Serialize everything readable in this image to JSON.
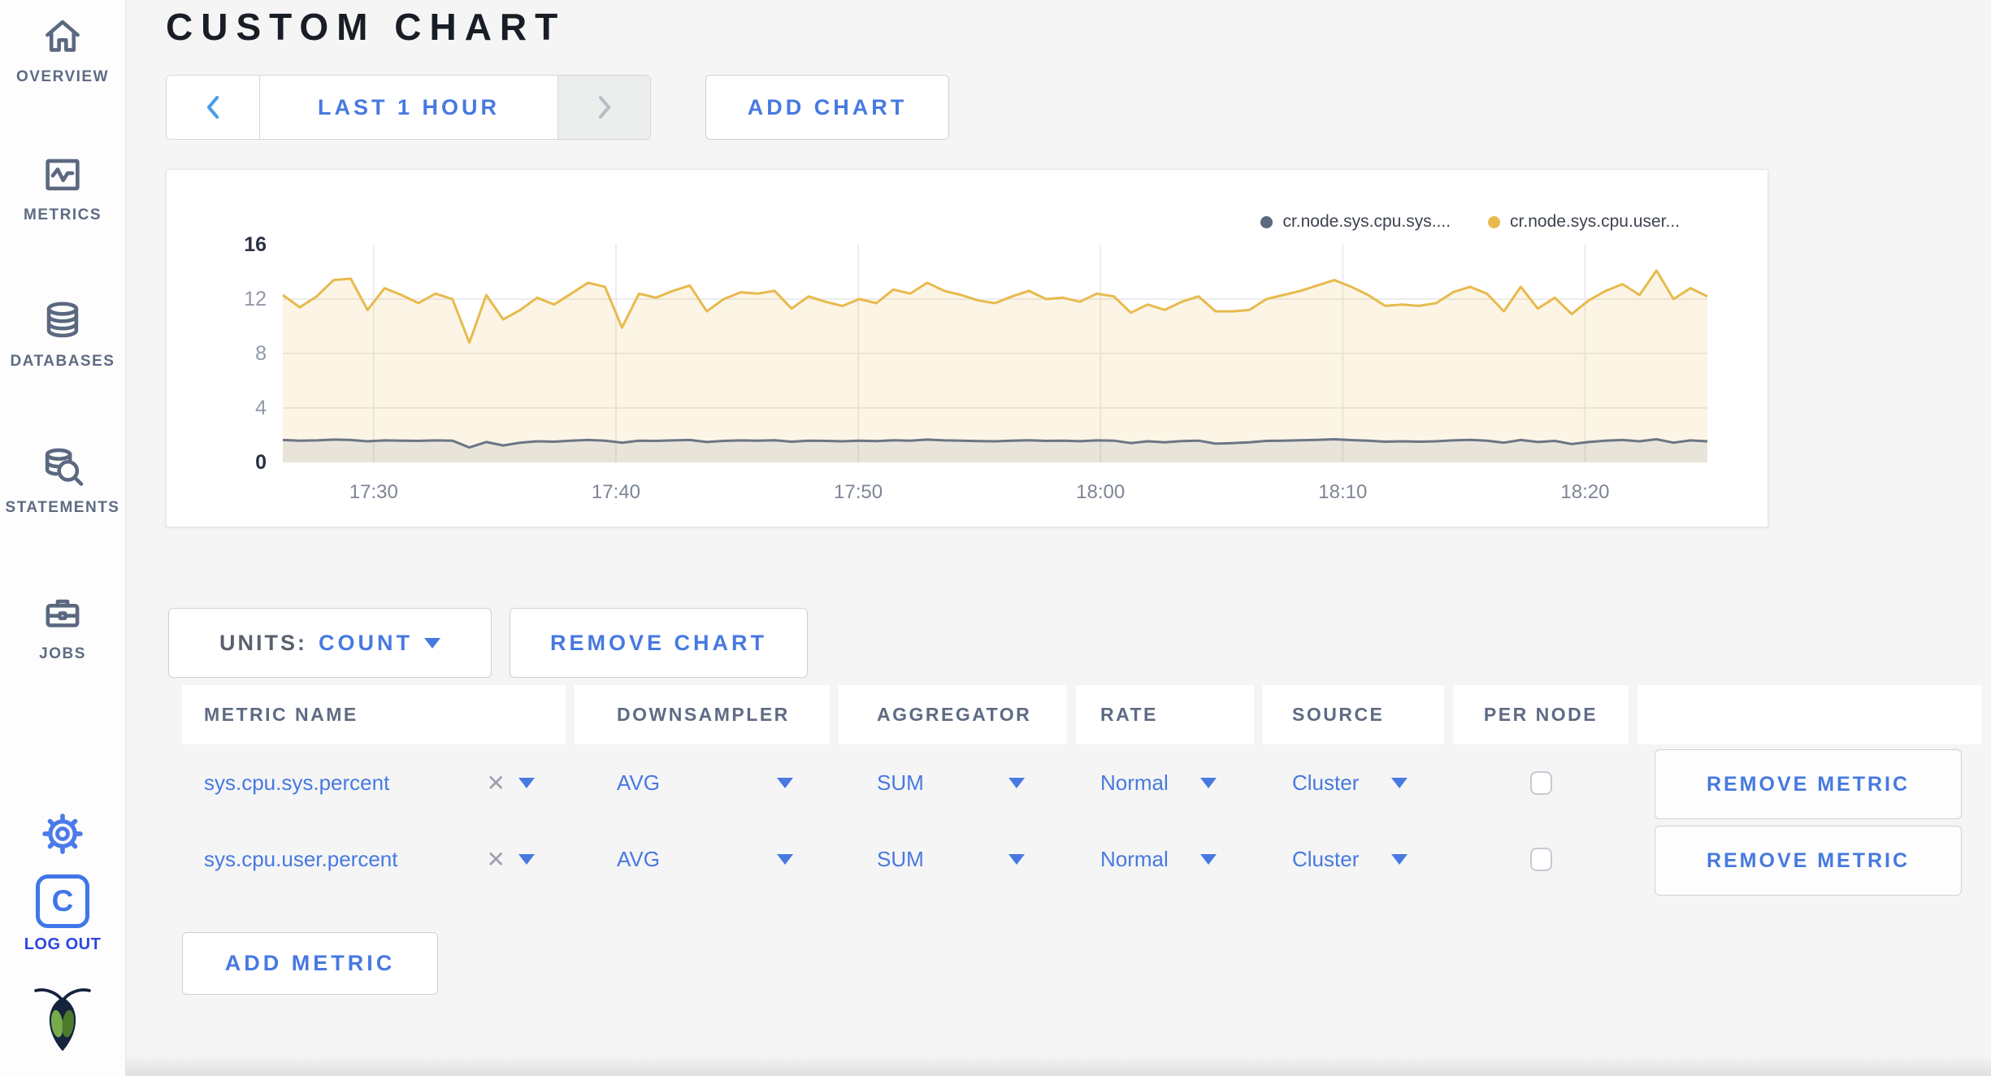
{
  "header": {
    "title": "CUSTOM CHART"
  },
  "sidebar": {
    "items": [
      {
        "label": "OVERVIEW"
      },
      {
        "label": "METRICS"
      },
      {
        "label": "DATABASES"
      },
      {
        "label": "STATEMENTS"
      },
      {
        "label": "JOBS"
      }
    ],
    "logo_letter": "C",
    "logout_label": "LOG OUT"
  },
  "controls": {
    "time_range": "LAST 1 HOUR",
    "add_chart": "ADD CHART"
  },
  "chart_card": {
    "legend": [
      {
        "label": "cr.node.sys.cpu.sys....",
        "color": "#5b6880"
      },
      {
        "label": "cr.node.sys.cpu.user...",
        "color": "#e8ba4d"
      }
    ]
  },
  "chart_data": {
    "type": "area",
    "title": "",
    "xlabel": "",
    "ylabel": "",
    "ylim": [
      0,
      16
    ],
    "y_ticks": [
      0,
      4,
      8,
      12,
      16
    ],
    "x_domain_minutes": [
      0,
      58.8
    ],
    "sample_interval_minutes": 0.7,
    "x_ticks": [
      {
        "label": "17:30",
        "min": 3.75
      },
      {
        "label": "17:40",
        "min": 13.75
      },
      {
        "label": "17:50",
        "min": 23.75
      },
      {
        "label": "18:00",
        "min": 33.75
      },
      {
        "label": "18:10",
        "min": 43.75
      },
      {
        "label": "18:20",
        "min": 53.75
      }
    ],
    "grid": true,
    "legend_position": "top-right",
    "series": [
      {
        "name": "cr.node.sys.cpu.sys....",
        "color": "#6b7585",
        "fill": "rgba(107,117,133,0.13)",
        "values": [
          1.65,
          1.6,
          1.62,
          1.68,
          1.65,
          1.55,
          1.62,
          1.6,
          1.58,
          1.62,
          1.6,
          1.1,
          1.5,
          1.25,
          1.45,
          1.55,
          1.52,
          1.6,
          1.65,
          1.6,
          1.45,
          1.6,
          1.58,
          1.62,
          1.65,
          1.5,
          1.58,
          1.62,
          1.6,
          1.63,
          1.52,
          1.6,
          1.58,
          1.55,
          1.6,
          1.57,
          1.63,
          1.6,
          1.68,
          1.62,
          1.6,
          1.57,
          1.55,
          1.6,
          1.63,
          1.58,
          1.6,
          1.56,
          1.62,
          1.6,
          1.42,
          1.55,
          1.48,
          1.57,
          1.6,
          1.38,
          1.42,
          1.48,
          1.58,
          1.6,
          1.63,
          1.66,
          1.7,
          1.64,
          1.6,
          1.52,
          1.55,
          1.52,
          1.55,
          1.62,
          1.66,
          1.6,
          1.45,
          1.65,
          1.5,
          1.58,
          1.35,
          1.5,
          1.6,
          1.65,
          1.55,
          1.7,
          1.45,
          1.62,
          1.55
        ]
      },
      {
        "name": "cr.node.sys.cpu.user...",
        "color": "#e8ba4d",
        "fill": "rgba(232,186,77,0.14)",
        "values": [
          12.3,
          11.4,
          12.2,
          13.4,
          13.5,
          11.2,
          12.8,
          12.3,
          11.7,
          12.4,
          12.0,
          8.8,
          12.3,
          10.5,
          11.2,
          12.1,
          11.6,
          12.4,
          13.2,
          12.9,
          9.9,
          12.4,
          12.1,
          12.6,
          13.0,
          11.1,
          12.0,
          12.5,
          12.4,
          12.6,
          11.3,
          12.2,
          11.8,
          11.5,
          12.0,
          11.7,
          12.7,
          12.4,
          13.2,
          12.6,
          12.3,
          11.9,
          11.7,
          12.2,
          12.6,
          12.0,
          12.1,
          11.8,
          12.4,
          12.2,
          11.0,
          11.6,
          11.2,
          11.8,
          12.2,
          11.1,
          11.1,
          11.2,
          12.0,
          12.3,
          12.6,
          13.0,
          13.4,
          12.9,
          12.3,
          11.5,
          11.6,
          11.5,
          11.7,
          12.5,
          12.9,
          12.4,
          11.1,
          12.9,
          11.3,
          12.1,
          10.9,
          11.9,
          12.6,
          13.1,
          12.3,
          14.1,
          12.0,
          12.8,
          12.2
        ]
      }
    ]
  },
  "units": {
    "label": "UNITS:",
    "value": "COUNT"
  },
  "remove_chart_label": "REMOVE CHART",
  "table": {
    "headers": [
      "METRIC NAME",
      "DOWNSAMPLER",
      "AGGREGATOR",
      "RATE",
      "SOURCE",
      "PER NODE",
      ""
    ],
    "remove_metric_label": "REMOVE METRIC",
    "rows": [
      {
        "metric": "sys.cpu.sys.percent",
        "downsampler": "AVG",
        "aggregator": "SUM",
        "rate": "Normal",
        "source": "Cluster",
        "per_node_checked": false
      },
      {
        "metric": "sys.cpu.user.percent",
        "downsampler": "AVG",
        "aggregator": "SUM",
        "rate": "Normal",
        "source": "Cluster",
        "per_node_checked": false
      }
    ]
  },
  "add_metric_label": "ADD METRIC",
  "colors": {
    "accent_blue": "#4779e0",
    "slate": "#5f6b84",
    "series_yellow": "#e8ba4d",
    "series_grey": "#6b7585",
    "logout_blue": "#2d47e0",
    "title": "#191d25",
    "page_bg": "#f5f5f6"
  }
}
